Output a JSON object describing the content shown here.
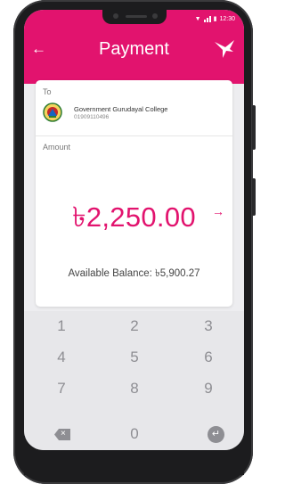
{
  "status_bar": {
    "time": "12:30"
  },
  "header": {
    "title": "Payment",
    "brand_color": "#e2136e"
  },
  "payee": {
    "to_label": "To",
    "name": "Government Gurudayal College",
    "number": "01909110496"
  },
  "amount": {
    "label": "Amount",
    "value": "৳2,250.00",
    "arrow": "→"
  },
  "balance": {
    "text": "Available Balance: ৳5,900.27"
  },
  "keypad": {
    "keys": [
      "1",
      "2",
      "3",
      "4",
      "5",
      "6",
      "7",
      "8",
      "9",
      "0"
    ],
    "delete_icon": "backspace-icon",
    "enter_icon": "enter-icon"
  }
}
